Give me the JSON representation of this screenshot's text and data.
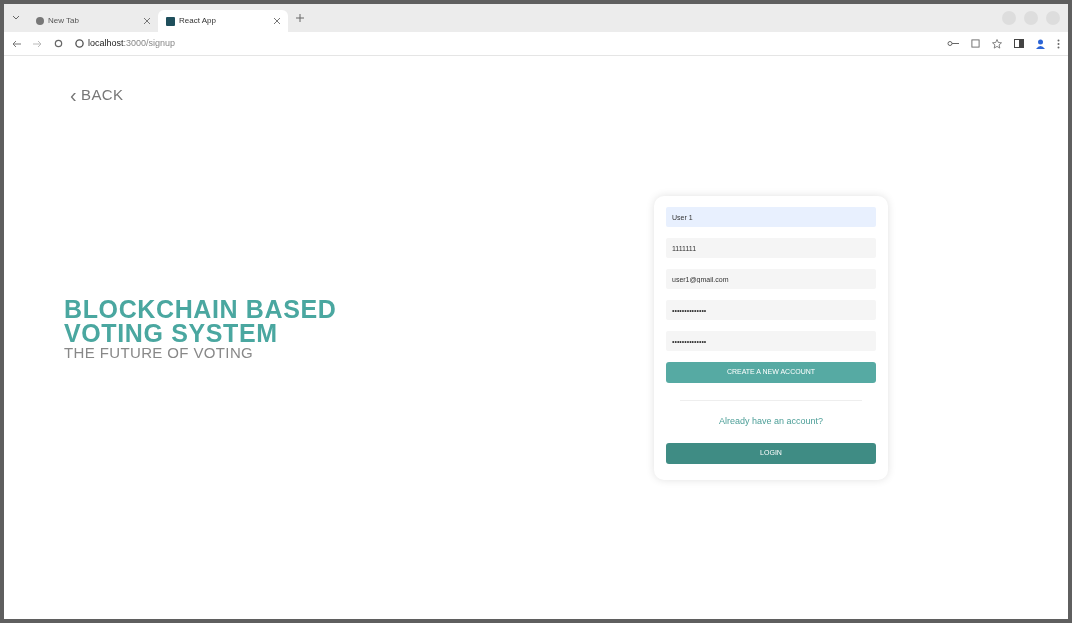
{
  "browser": {
    "tabs": [
      {
        "title": "New Tab",
        "selected": false
      },
      {
        "title": "React App",
        "selected": true
      }
    ],
    "url_host": "localhost",
    "url_path": ":3000/signup"
  },
  "back": {
    "icon": "‹",
    "label": "BACK"
  },
  "hero": {
    "title_lines": [
      "BLOCKCHAIN BASED",
      "VOTING SYSTEM"
    ],
    "subtitle": "THE FUTURE OF VOTING"
  },
  "form": {
    "fields": [
      {
        "value": "User 1",
        "focused": true
      },
      {
        "value": "1111111",
        "focused": false
      },
      {
        "value": "user1@gmail.com",
        "focused": false
      },
      {
        "value": "••••••••••••••",
        "focused": false
      },
      {
        "value": "••••••••••••••",
        "focused": false
      }
    ],
    "create_button": "CREATE A NEW ACCOUNT",
    "prompt": "Already have an account?",
    "login_button": "LOGIN"
  }
}
